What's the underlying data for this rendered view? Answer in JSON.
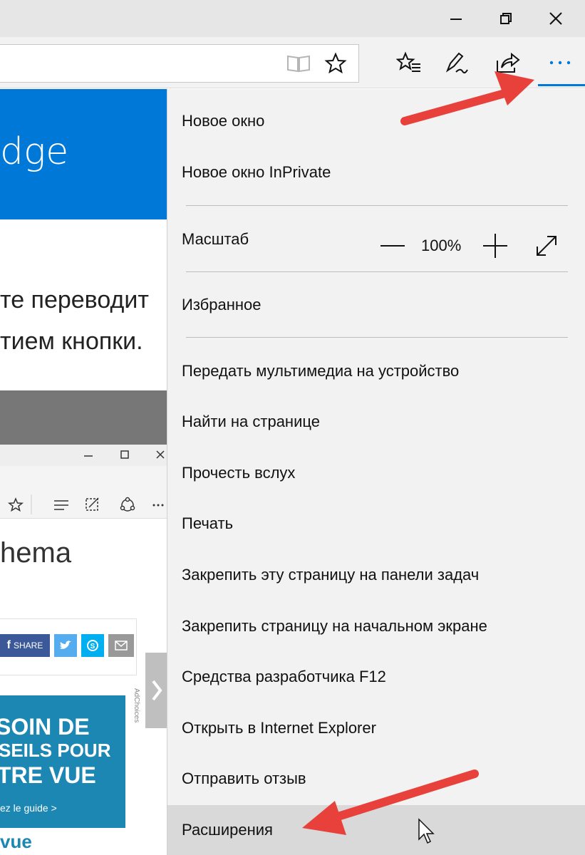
{
  "window": {
    "controls": [
      "minimize-icon",
      "restore-icon",
      "close-icon"
    ]
  },
  "toolbar": {
    "icons": [
      "reading-view-icon",
      "favorite-star-icon",
      "favorites-hub-icon",
      "web-note-icon",
      "share-icon",
      "more-actions-icon"
    ],
    "accent": "#0078d7"
  },
  "page": {
    "hero_text": "dge",
    "line1": "те переводит",
    "line2": "тием кнопки.",
    "inner_heading": "hema",
    "social_share": "SHARE",
    "ad_lines": [
      "SOIN DE",
      "SEILS POUR",
      "TRE VUE"
    ],
    "ad_guide": "ez le guide >",
    "ad_brand": "vue",
    "adchoices": "AdChoices"
  },
  "menu": {
    "new_window": "Новое окно",
    "new_inprivate": "Новое окно InPrivate",
    "zoom_label": "Масштаб",
    "zoom_value": "100%",
    "favorites": "Избранное",
    "cast": "Передать мультимедиа на устройство",
    "find": "Найти на странице",
    "read_aloud": "Прочесть вслух",
    "print": "Печать",
    "pin_taskbar": "Закрепить эту страницу на панели задач",
    "pin_start": "Закрепить страницу на начальном экране",
    "devtools": "Средства разработчика F12",
    "open_ie": "Открыть в Internet Explorer",
    "feedback": "Отправить отзыв",
    "extensions": "Расширения"
  },
  "colors": {
    "annotation_arrow": "#e8413c",
    "menu_bg": "#f2f2f2",
    "hover_bg": "#d9d9d9"
  }
}
